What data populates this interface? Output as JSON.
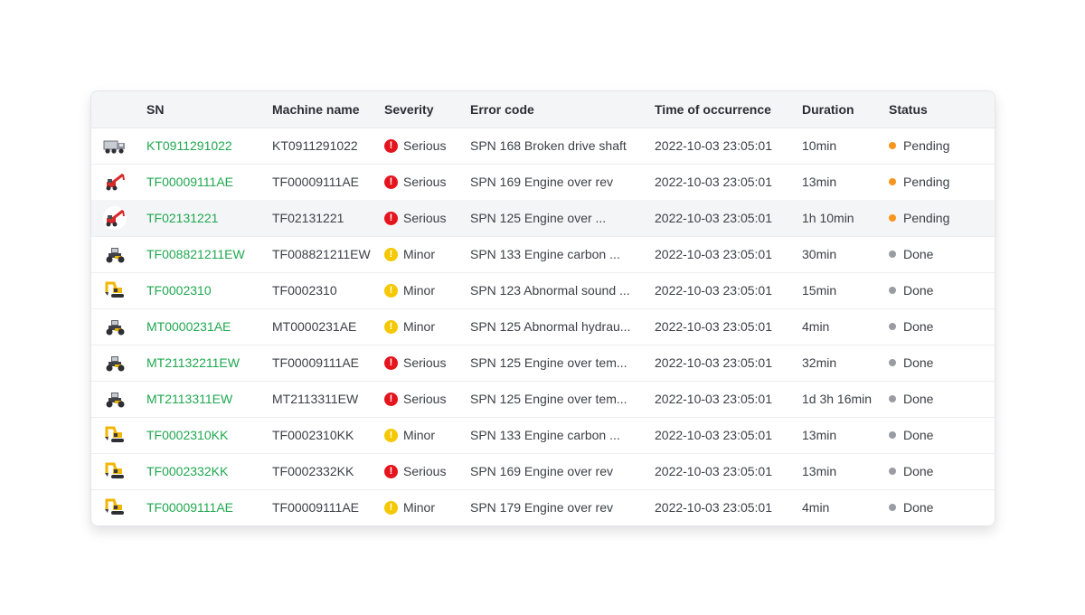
{
  "columns": {
    "sn": "SN",
    "machine_name": "Machine name",
    "severity": "Severity",
    "error_code": "Error code",
    "time": "Time of occurrence",
    "duration": "Duration",
    "status": "Status"
  },
  "colors": {
    "link": "#1fa84f",
    "serious": "#e5141d",
    "minor": "#f5c800",
    "pending": "#f7951d",
    "done": "#9a9ca3"
  },
  "rows": [
    {
      "icon": "truck-icon",
      "sn": "KT0911291022",
      "name": "KT0911291022",
      "severity": "Serious",
      "error": "SPN 168 Broken drive shaft",
      "time": "2022-10-03 23:05:01",
      "duration": "10min",
      "status": "Pending"
    },
    {
      "icon": "reach-stacker-icon",
      "sn": "TF00009111AE",
      "name": "TF00009111AE",
      "severity": "Serious",
      "error": "SPN 169 Engine over rev",
      "time": "2022-10-03 23:05:01",
      "duration": "13min",
      "status": "Pending"
    },
    {
      "icon": "reach-stacker-icon",
      "sn": "TF02131221",
      "name": "TF02131221",
      "severity": "Serious",
      "error": "SPN 125 Engine over ...",
      "time": "2022-10-03 23:05:01",
      "duration": "1h 10min",
      "status": "Pending"
    },
    {
      "icon": "roller-icon",
      "sn": "TF008821211EW",
      "name": "TF008821211EW",
      "severity": "Minor",
      "error": "SPN 133 Engine carbon ...",
      "time": "2022-10-03 23:05:01",
      "duration": "30min",
      "status": "Done"
    },
    {
      "icon": "excavator-icon",
      "sn": "TF0002310",
      "name": "TF0002310",
      "severity": "Minor",
      "error": "SPN 123 Abnormal sound ...",
      "time": "2022-10-03 23:05:01",
      "duration": "15min",
      "status": "Done"
    },
    {
      "icon": "roller-icon",
      "sn": "MT0000231AE",
      "name": "MT0000231AE",
      "severity": "Minor",
      "error": "SPN 125 Abnormal hydrau...",
      "time": "2022-10-03 23:05:01",
      "duration": "4min",
      "status": "Done"
    },
    {
      "icon": "roller-icon",
      "sn": "MT21132211EW",
      "name": "TF00009111AE",
      "severity": "Serious",
      "error": "SPN 125 Engine over tem...",
      "time": "2022-10-03 23:05:01",
      "duration": "32min",
      "status": "Done"
    },
    {
      "icon": "roller-icon",
      "sn": "MT2113311EW",
      "name": "MT2113311EW",
      "severity": "Serious",
      "error": "SPN 125 Engine over tem...",
      "time": "2022-10-03 23:05:01",
      "duration": "1d 3h 16min",
      "status": "Done"
    },
    {
      "icon": "excavator-icon",
      "sn": "TF0002310KK",
      "name": "TF0002310KK",
      "severity": "Minor",
      "error": "SPN 133 Engine carbon ...",
      "time": "2022-10-03 23:05:01",
      "duration": "13min",
      "status": "Done"
    },
    {
      "icon": "excavator-icon",
      "sn": "TF0002332KK",
      "name": "TF0002332KK",
      "severity": "Serious",
      "error": "SPN 169 Engine over rev",
      "time": "2022-10-03 23:05:01",
      "duration": "13min",
      "status": "Done"
    },
    {
      "icon": "excavator-icon",
      "sn": "TF00009111AE",
      "name": "TF00009111AE",
      "severity": "Minor",
      "error": "SPN 179 Engine over rev",
      "time": "2022-10-03 23:05:01",
      "duration": "4min",
      "status": "Done"
    }
  ]
}
